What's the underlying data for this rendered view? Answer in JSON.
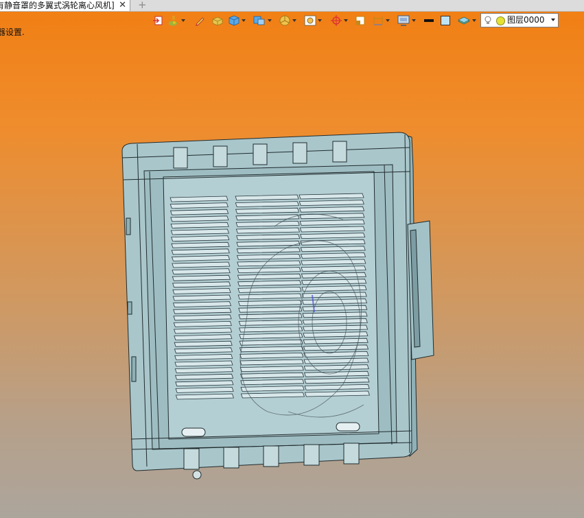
{
  "tab": {
    "title": "有静音罩的多翼式涡轮离心风机]",
    "close": "✕",
    "new_tab": "+"
  },
  "status_text": "器设置.",
  "toolbar": {
    "icons": [
      "import-icon",
      "paint-icon",
      "pencil-icon",
      "box-icon",
      "cube-icon",
      "cube-view-icon",
      "pie-section-icon",
      "zoom-frame-icon",
      "axis-icon",
      "rect-select-icon",
      "dimension-icon",
      "render-icon",
      "line-color",
      "fill-color",
      "layer-stack-icon"
    ]
  },
  "layer": {
    "label": "图层0000"
  },
  "colors": {
    "model_fill": "#a9c6cb",
    "model_line": "#1f2a2c"
  }
}
